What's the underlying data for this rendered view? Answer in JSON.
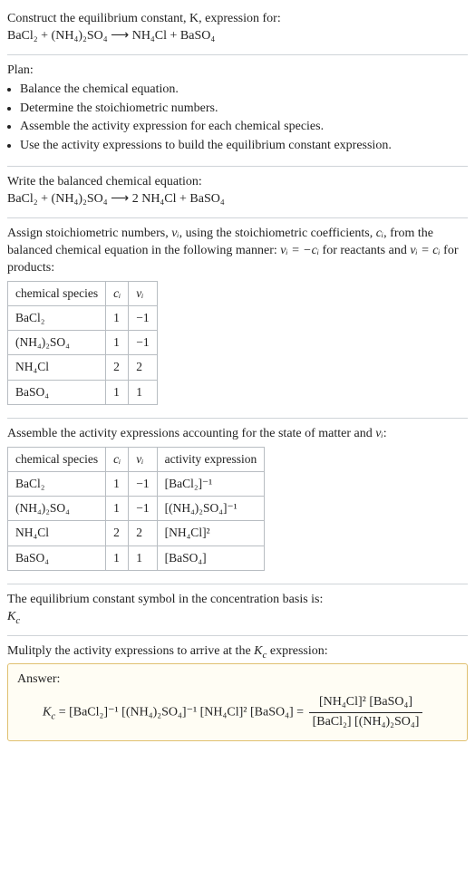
{
  "intro": {
    "line1": "Construct the equilibrium constant, K, expression for:",
    "eq": "BaCl₂ + (NH₄)₂SO₄ ⟶ NH₄Cl + BaSO₄"
  },
  "plan": {
    "heading": "Plan:",
    "items": [
      "Balance the chemical equation.",
      "Determine the stoichiometric numbers.",
      "Assemble the activity expression for each chemical species.",
      "Use the activity expressions to build the equilibrium constant expression."
    ]
  },
  "balanced": {
    "heading": "Write the balanced chemical equation:",
    "eq": "BaCl₂ + (NH₄)₂SO₄ ⟶ 2 NH₄Cl + BaSO₄"
  },
  "stoich": {
    "heading_a": "Assign stoichiometric numbers, ",
    "heading_b": ", using the stoichiometric coefficients, ",
    "heading_c": ", from the balanced chemical equation in the following manner: ",
    "heading_d": " for reactants and ",
    "heading_e": " for products:",
    "nu_i": "νᵢ",
    "c_i": "cᵢ",
    "rel_react": "νᵢ = −cᵢ",
    "rel_prod": "νᵢ = cᵢ",
    "cols": {
      "species": "chemical species",
      "ci": "cᵢ",
      "vi": "νᵢ"
    },
    "rows": [
      {
        "s": "BaCl₂",
        "c": "1",
        "v": "−1"
      },
      {
        "s": "(NH₄)₂SO₄",
        "c": "1",
        "v": "−1"
      },
      {
        "s": "NH₄Cl",
        "c": "2",
        "v": "2"
      },
      {
        "s": "BaSO₄",
        "c": "1",
        "v": "1"
      }
    ]
  },
  "activity": {
    "heading_a": "Assemble the activity expressions accounting for the state of matter and ",
    "heading_b": ":",
    "nu_i": "νᵢ",
    "cols": {
      "species": "chemical species",
      "ci": "cᵢ",
      "vi": "νᵢ",
      "act": "activity expression"
    },
    "rows": [
      {
        "s": "BaCl₂",
        "c": "1",
        "v": "−1",
        "a": "[BaCl₂]⁻¹"
      },
      {
        "s": "(NH₄)₂SO₄",
        "c": "1",
        "v": "−1",
        "a": "[(NH₄)₂SO₄]⁻¹"
      },
      {
        "s": "NH₄Cl",
        "c": "2",
        "v": "2",
        "a": "[NH₄Cl]²"
      },
      {
        "s": "BaSO₄",
        "c": "1",
        "v": "1",
        "a": "[BaSO₄]"
      }
    ]
  },
  "symbol": {
    "heading": "The equilibrium constant symbol in the concentration basis is:",
    "k": "K",
    "ksub": "c"
  },
  "multiply": {
    "heading_a": "Mulitply the activity expressions to arrive at the ",
    "heading_b": " expression:",
    "k": "K",
    "ksub": "c"
  },
  "answer": {
    "label": "Answer:",
    "lhs_k": "K",
    "lhs_ksub": "c",
    "mid": " = [BaCl₂]⁻¹ [(NH₄)₂SO₄]⁻¹ [NH₄Cl]² [BaSO₄] = ",
    "num": "[NH₄Cl]² [BaSO₄]",
    "den": "[BaCl₂] [(NH₄)₂SO₄]"
  }
}
